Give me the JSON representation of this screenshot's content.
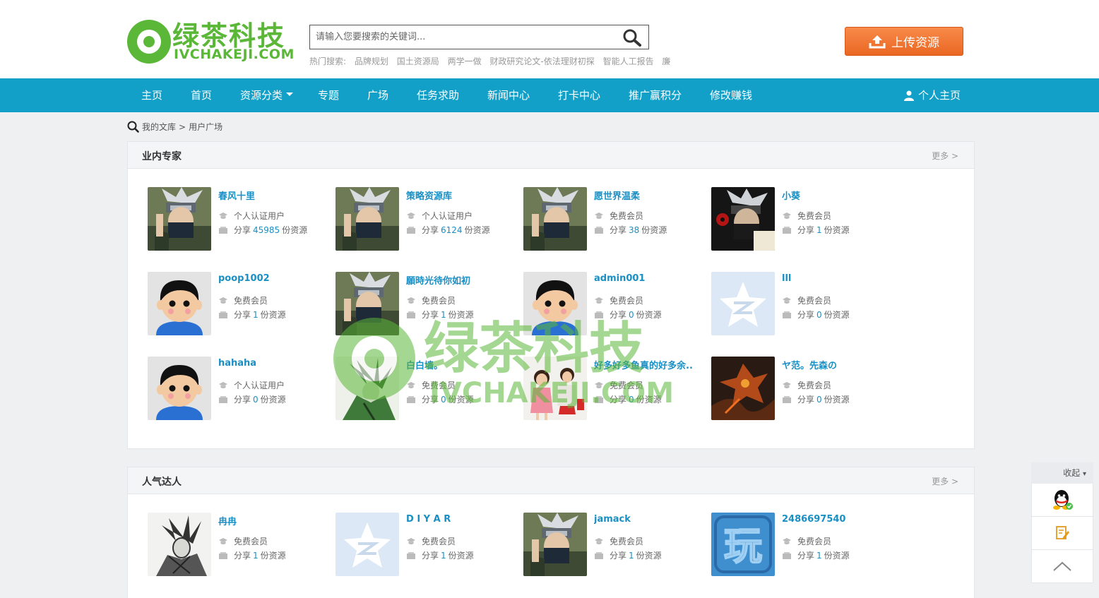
{
  "logo": {
    "cn": "绿茶科技",
    "en": "IVCHAKEJI.COM"
  },
  "search": {
    "placeholder": "请输入您要搜索的关键词...",
    "hot_label": "热门搜索:",
    "hot": [
      "品牌规划",
      "国土资源局",
      "两学一做",
      "财政研究论文-依法理财初探",
      "智能人工报告",
      "廉"
    ]
  },
  "upload_label": "上传资源",
  "nav": {
    "items": [
      "主页",
      "首页",
      "资源分类",
      "专题",
      "广场",
      "任务求助",
      "新闻中心",
      "打卡中心",
      "推广赢积分",
      "修改赚钱"
    ],
    "user": "个人主页"
  },
  "breadcrumb": {
    "root": "我的文库",
    "sep": ">",
    "current": "用户广场"
  },
  "experts": {
    "title": "业内专家",
    "more": "更多 >",
    "users": [
      {
        "name": "春风十里",
        "role": "个人认证用户",
        "count": "45985",
        "avatar": "ninja"
      },
      {
        "name": "策略资源库",
        "role": "个人认证用户",
        "count": "6124",
        "avatar": "ninja"
      },
      {
        "name": "愿世界温柔",
        "role": "免费会员",
        "count": "38",
        "avatar": "ninja"
      },
      {
        "name": "小葵",
        "role": "免费会员",
        "count": "1",
        "avatar": "ninja-dark"
      },
      {
        "name": "poop1002",
        "role": "免费会员",
        "count": "1",
        "avatar": "boy"
      },
      {
        "name": "願時光待你如初",
        "role": "免费会员",
        "count": "1",
        "avatar": "ninja"
      },
      {
        "name": "admin001",
        "role": "免费会员",
        "count": "0",
        "avatar": "boy"
      },
      {
        "name": "lll",
        "role": "免费会员",
        "count": "0",
        "avatar": "star"
      },
      {
        "name": "hahaha",
        "role": "个人认证用户",
        "count": "0",
        "avatar": "boy"
      },
      {
        "name": "白白墙。",
        "role": "免费会员",
        "count": "0",
        "avatar": "green-warrior"
      },
      {
        "name": "好多好多鱼真的好多余...",
        "role": "免费会员",
        "count": "0",
        "avatar": "kids"
      },
      {
        "name": "ヤ范。先森の",
        "role": "免费会员",
        "count": "0",
        "avatar": "dragon"
      }
    ]
  },
  "popular": {
    "title": "人气达人",
    "more": "更多 >",
    "users": [
      {
        "name": "冉冉",
        "role": "免费会员",
        "count": "1",
        "avatar": "sketch"
      },
      {
        "name": "D I Y A R",
        "role": "免费会员",
        "count": "1",
        "avatar": "star"
      },
      {
        "name": "jamack",
        "role": "免费会员",
        "count": "1",
        "avatar": "ninja"
      },
      {
        "name": "2486697540",
        "role": "免费会员",
        "count": "1",
        "avatar": "play"
      }
    ]
  },
  "labels": {
    "share_prefix": "分享",
    "share_suffix": "份资源"
  },
  "watermark": {
    "cn": "绿茶科技",
    "en": "IVCHAKEJI.COM"
  },
  "side": {
    "collapse": "收起",
    "icons": [
      "qq-icon",
      "feedback-icon",
      "back-to-top-icon"
    ]
  },
  "colors": {
    "nav": "#12a0c8",
    "brand": "#5bb738",
    "upload": "#ea6722",
    "link": "#1a8fc4"
  }
}
